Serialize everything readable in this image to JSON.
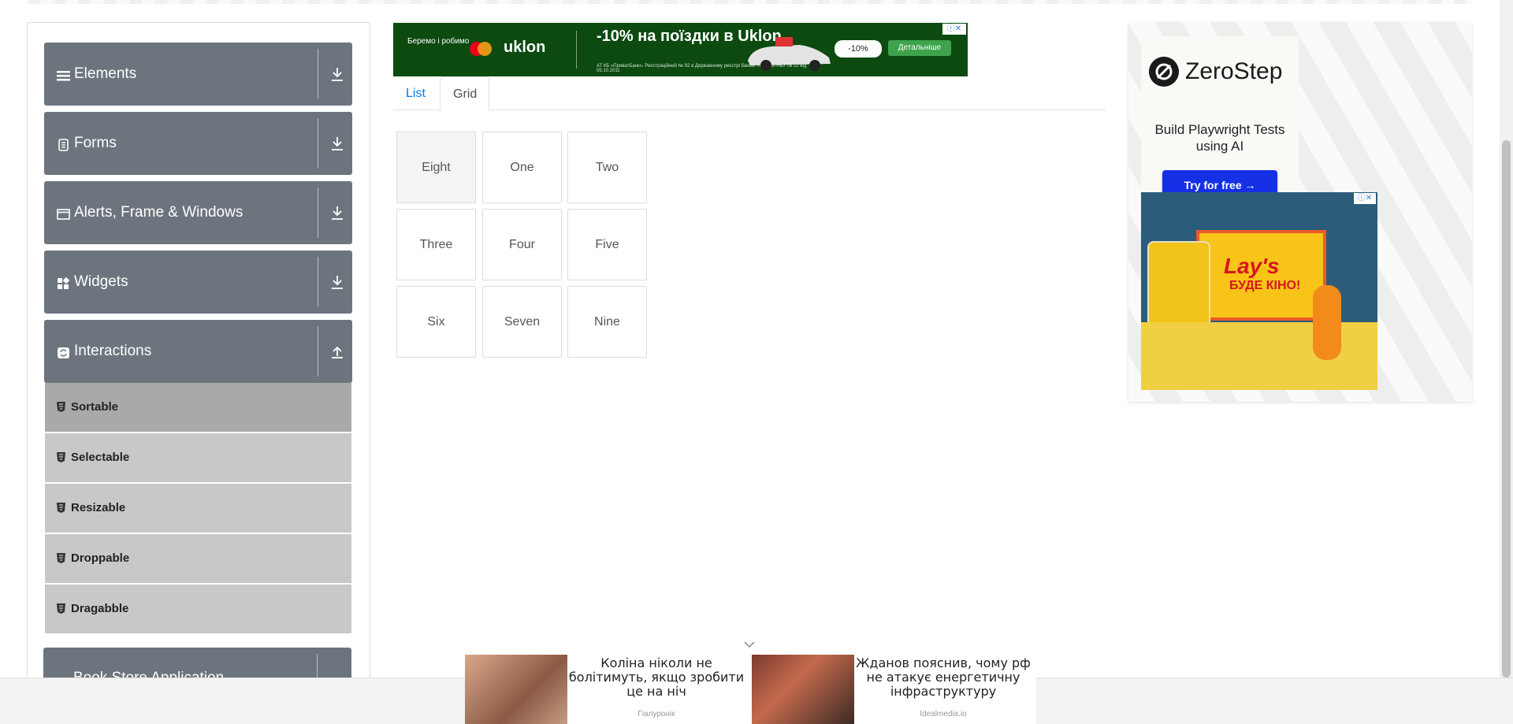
{
  "sidebar": {
    "groups": [
      {
        "label": "Elements",
        "icon": "list-icon",
        "expanded": false
      },
      {
        "label": "Forms",
        "icon": "form-icon",
        "expanded": false
      },
      {
        "label": "Alerts, Frame & Windows",
        "icon": "window-icon",
        "expanded": false
      },
      {
        "label": "Widgets",
        "icon": "widgets-icon",
        "expanded": false
      },
      {
        "label": "Interactions",
        "icon": "interactions-icon",
        "expanded": true
      },
      {
        "label": "Book Store Application",
        "icon": "book-icon",
        "expanded": false
      }
    ],
    "interaction_items": [
      {
        "label": "Sortable",
        "active": true
      },
      {
        "label": "Selectable",
        "active": false
      },
      {
        "label": "Resizable",
        "active": false
      },
      {
        "label": "Droppable",
        "active": false
      },
      {
        "label": "Dragabble",
        "active": false
      }
    ]
  },
  "top_ad": {
    "brand": "Беремо і робимо",
    "company": "uklon",
    "headline": "-10% на поїздки в Uklon",
    "fineprint": "АТ КБ «ПриватБанк». Реєстраційний № 92 в Державному реєстрі банків. Ліцензія НБУ № 22 від 05.10.2011",
    "badge": "-10%",
    "cta": "Детальніше"
  },
  "tabs": [
    {
      "label": "List",
      "active": false
    },
    {
      "label": "Grid",
      "active": true
    }
  ],
  "grid_items": [
    "Eight",
    "One",
    "Two",
    "Three",
    "Four",
    "Five",
    "Six",
    "Seven",
    "Nine"
  ],
  "right_ad": {
    "brand": "ZeroStep",
    "tagline": "Build Playwright Tests using AI",
    "cta": "Try for free →"
  },
  "lays_ad": {
    "logo": "Lay's",
    "text": "БУДЕ КІНО!"
  },
  "native_ads": [
    {
      "text": "Коліна ніколи не болітимуть, якщо зробити це на ніч",
      "source": "Гіалуронік"
    },
    {
      "text": "Жданов пояснив, чому рф не атакує енергетичну інфраструктуру",
      "source": "Idealmedia.io"
    }
  ],
  "colors": {
    "sidebar_header": "#6c757d",
    "sub_item": "#c8c8c8",
    "sub_item_active": "#a9a9a9",
    "link": "#007bff",
    "zerostep_button": "#1630e6"
  }
}
